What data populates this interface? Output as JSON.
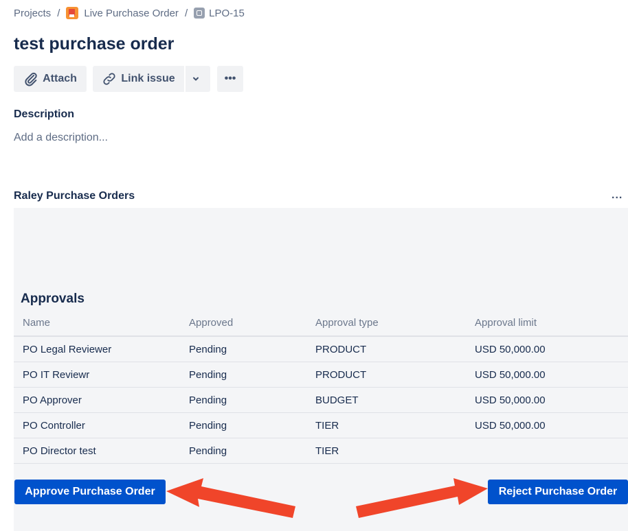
{
  "breadcrumb": {
    "items": [
      "Projects",
      "Live Purchase Order",
      "LPO-15"
    ],
    "separator": "/"
  },
  "issue": {
    "title": "test purchase order"
  },
  "toolbar": {
    "attach_label": "Attach",
    "link_issue_label": "Link issue",
    "more_label": "•••"
  },
  "description": {
    "heading": "Description",
    "placeholder": "Add a description..."
  },
  "panel": {
    "title": "Raley Purchase Orders",
    "more_label": "...",
    "approvals": {
      "heading": "Approvals",
      "columns": [
        "Name",
        "Approved",
        "Approval type",
        "Approval limit"
      ],
      "rows": [
        [
          "PO Legal Reviewer",
          "Pending",
          "PRODUCT",
          "USD 50,000.00"
        ],
        [
          "PO IT Reviewr",
          "Pending",
          "PRODUCT",
          "USD 50,000.00"
        ],
        [
          "PO Approver",
          "Pending",
          "BUDGET",
          "USD 50,000.00"
        ],
        [
          "PO Controller",
          "Pending",
          "TIER",
          "USD 50,000.00"
        ],
        [
          "PO Director test",
          "Pending",
          "TIER",
          ""
        ]
      ]
    },
    "approve_label": "Approve Purchase Order",
    "reject_label": "Reject Purchase Order"
  },
  "colors": {
    "primary_button": "#0052cc",
    "annotation_arrow": "#f0452a",
    "panel_background": "#f4f5f7"
  }
}
